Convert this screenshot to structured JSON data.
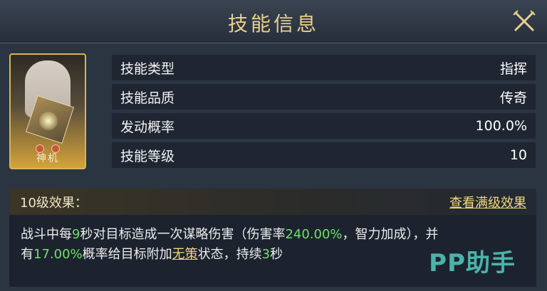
{
  "header": {
    "title": "技能信息"
  },
  "skill_card": {
    "name": "神机"
  },
  "attributes": [
    {
      "label": "技能类型",
      "value": "指挥"
    },
    {
      "label": "技能品质",
      "value": "传奇"
    },
    {
      "label": "发动概率",
      "value": "100.0%"
    },
    {
      "label": "技能等级",
      "value": "10"
    }
  ],
  "effect": {
    "level_title": "10级效果：",
    "view_max_label": "查看满级效果",
    "text": {
      "p1": "战斗中每",
      "seconds": "9",
      "p2": "秒对目标造成一次谋略伤害（伤害率",
      "damage_rate": "240.00%",
      "p3": "，智力加成），并",
      "p4": "有",
      "chance": "17.00%",
      "p5": "概率给目标附加",
      "status": "无策",
      "p6": "状态，持续",
      "duration": "3",
      "p7": "秒"
    }
  },
  "watermark": "PP助手",
  "colors": {
    "title_gold": "#e8cf8d",
    "highlight_green": "#6ee06a",
    "link_gold": "#f0d77e"
  }
}
